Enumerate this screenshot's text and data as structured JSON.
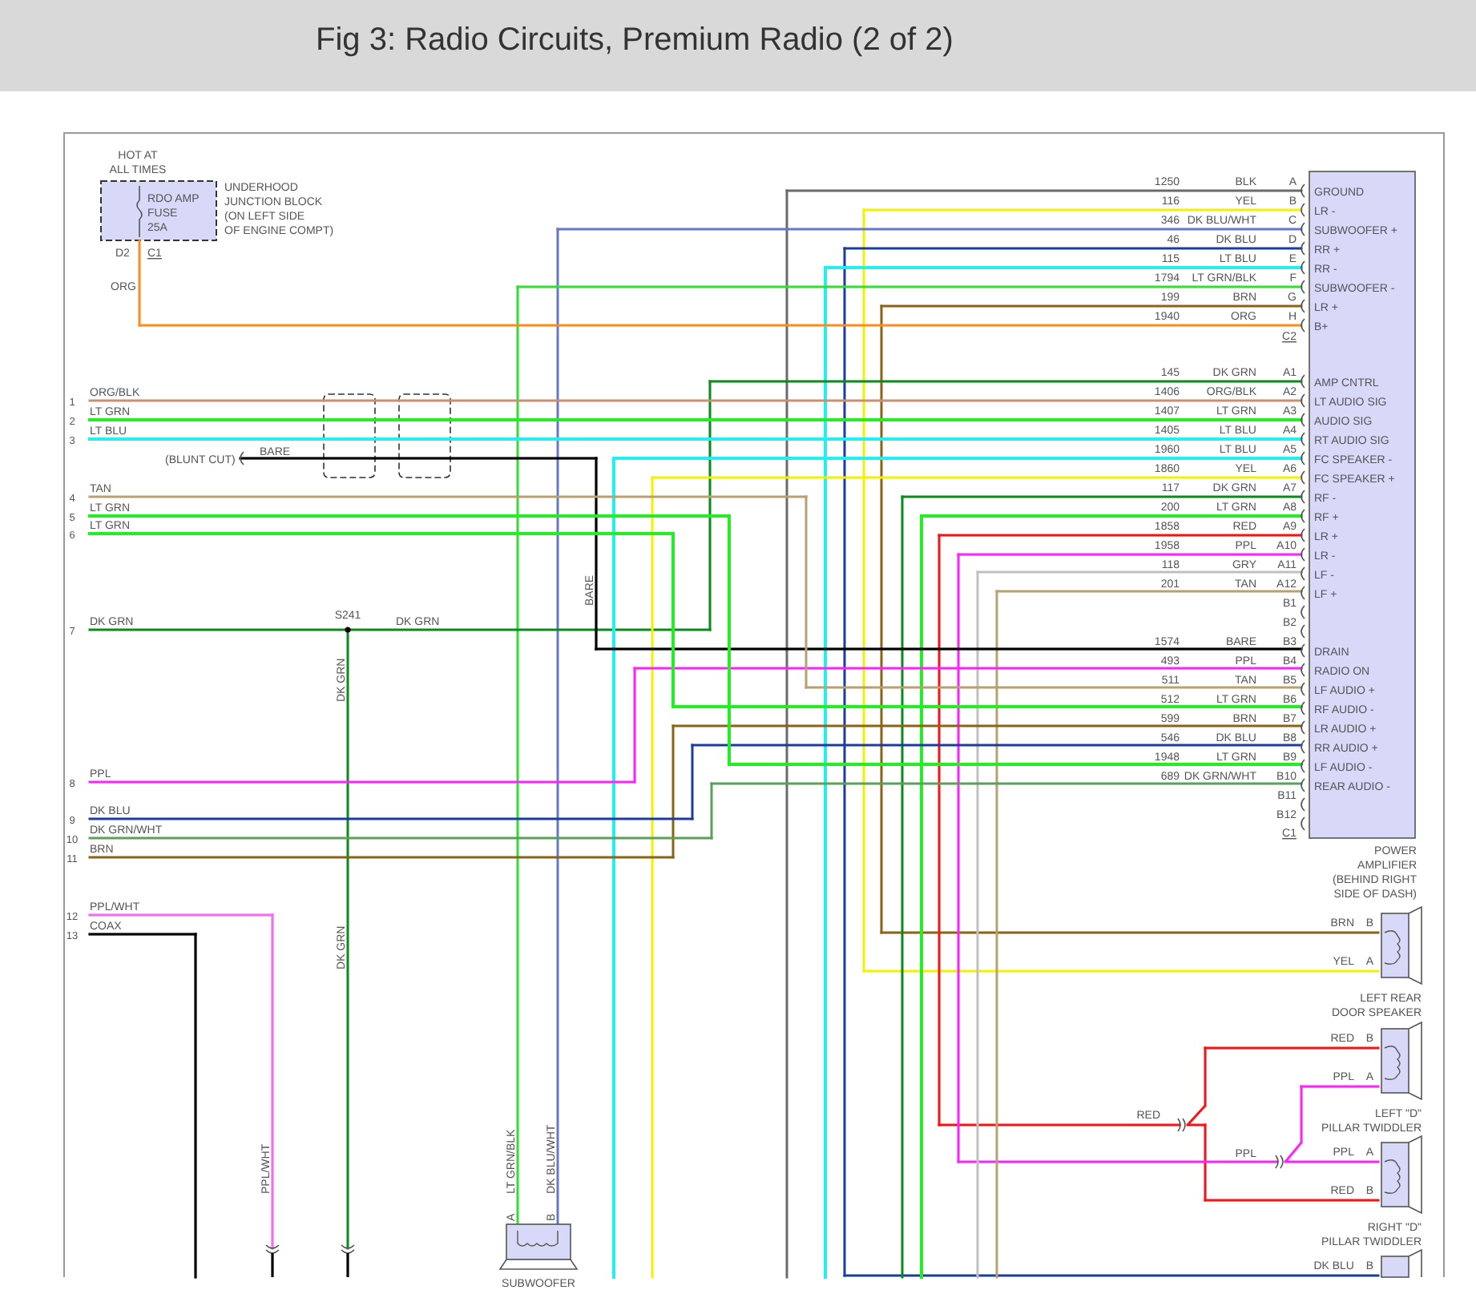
{
  "header": {
    "title": "Fig 3: Radio Circuits, Premium Radio (2 of 2)"
  },
  "fuse_block": {
    "supply_label": [
      "HOT AT",
      "ALL TIMES"
    ],
    "fuse_label": [
      "RDO AMP",
      "FUSE",
      "25A"
    ],
    "location": [
      "UNDERHOOD",
      "JUNCTION BLOCK",
      "(ON LEFT SIDE",
      "OF ENGINE COMPT)"
    ],
    "pin": "D2",
    "connector": "C1",
    "wire": "ORG"
  },
  "harness_wires": [
    {
      "number": "1",
      "label": "ORG/BLK"
    },
    {
      "number": "2",
      "label": "LT GRN"
    },
    {
      "number": "3",
      "label": "LT BLU"
    },
    {
      "number": "4",
      "label": "TAN"
    },
    {
      "number": "5",
      "label": "LT GRN"
    },
    {
      "number": "6",
      "label": "LT GRN"
    },
    {
      "number": "7",
      "label": "DK GRN"
    },
    {
      "number": "8",
      "label": "PPL"
    },
    {
      "number": "9",
      "label": "DK BLU"
    },
    {
      "number": "10",
      "label": "DK GRN/WHT"
    },
    {
      "number": "11",
      "label": "BRN"
    },
    {
      "number": "12",
      "label": "PPL/WHT",
      "vertical_label": "PPL/WHT",
      "color": "#f070f0"
    },
    {
      "number": "13",
      "label": "COAX",
      "color": "#000000"
    }
  ],
  "drain": {
    "end_label": "(BLUNT CUT)",
    "wire": "BARE",
    "vertical_label": "BARE"
  },
  "splice": {
    "name": "S241",
    "wire_label": "DK GRN",
    "branch_labels": [
      "DK GRN",
      "DK GRN"
    ]
  },
  "power_amplifier": {
    "name": [
      "POWER",
      "AMPLIFIER",
      "(BEHIND RIGHT",
      "SIDE OF DASH)"
    ],
    "c2_pins": [
      {
        "circuit": "1250",
        "wire": "BLK",
        "pin": "A",
        "function": "GROUND",
        "color": "#6b6b6b"
      },
      {
        "circuit": "116",
        "wire": "YEL",
        "pin": "B",
        "function": "LR -",
        "color": "#f2f200"
      },
      {
        "circuit": "346",
        "wire": "DK BLU/WHT",
        "pin": "C",
        "function": "SUBWOOFER +",
        "color": "#6677cc"
      },
      {
        "circuit": "46",
        "wire": "DK BLU",
        "pin": "D",
        "function": "RR +",
        "color": "#1c3c9c"
      },
      {
        "circuit": "115",
        "wire": "LT BLU",
        "pin": "E",
        "function": "RR -",
        "color": "#22f0f0"
      },
      {
        "circuit": "1794",
        "wire": "LT GRN/BLK",
        "pin": "F",
        "function": "SUBWOOFER -",
        "color": "#33dd33"
      },
      {
        "circuit": "199",
        "wire": "BRN",
        "pin": "G",
        "function": "LR +",
        "color": "#8a6414"
      },
      {
        "circuit": "1940",
        "wire": "ORG",
        "pin": "H",
        "function": "B+",
        "color": "#ff8c1a"
      }
    ],
    "c2_label": "C2",
    "c1_pins": [
      {
        "circuit": "145",
        "wire": "DK GRN",
        "pin": "A1",
        "function": "AMP CNTRL",
        "color": "#0a8a1a"
      },
      {
        "circuit": "1406",
        "wire": "ORG/BLK",
        "pin": "A2",
        "function": "LT AUDIO SIG",
        "color": "#c89070"
      },
      {
        "circuit": "1407",
        "wire": "LT GRN",
        "pin": "A3",
        "function": "AUDIO SIG",
        "color": "#22ee22"
      },
      {
        "circuit": "1405",
        "wire": "LT BLU",
        "pin": "A4",
        "function": "RT AUDIO SIG",
        "color": "#22f0f0"
      },
      {
        "circuit": "1960",
        "wire": "LT BLU",
        "pin": "A5",
        "function": "FC SPEAKER -",
        "color": "#22f0f0"
      },
      {
        "circuit": "1860",
        "wire": "YEL",
        "pin": "A6",
        "function": "FC SPEAKER +",
        "color": "#f2f200"
      },
      {
        "circuit": "117",
        "wire": "DK GRN",
        "pin": "A7",
        "function": "RF -",
        "color": "#0a8a1a"
      },
      {
        "circuit": "200",
        "wire": "LT GRN",
        "pin": "A8",
        "function": "RF +",
        "color": "#22ee22"
      },
      {
        "circuit": "1858",
        "wire": "RED",
        "pin": "A9",
        "function": "LR +",
        "color": "#ff1010"
      },
      {
        "circuit": "1958",
        "wire": "PPL",
        "pin": "A10",
        "function": "LR -",
        "color": "#ff22ff"
      },
      {
        "circuit": "118",
        "wire": "GRY",
        "pin": "A11",
        "function": "LF -",
        "color": "#c0c0c0"
      },
      {
        "circuit": "201",
        "wire": "TAN",
        "pin": "A12",
        "function": "LF +",
        "color": "#b8a070"
      },
      {
        "pin": "B1"
      },
      {
        "pin": "B2"
      },
      {
        "circuit": "1574",
        "wire": "BARE",
        "pin": "B3",
        "function": "DRAIN",
        "color": "#000000"
      },
      {
        "circuit": "493",
        "wire": "PPL",
        "pin": "B4",
        "function": "RADIO ON",
        "color": "#ff22ff"
      },
      {
        "circuit": "511",
        "wire": "TAN",
        "pin": "B5",
        "function": "LF AUDIO +",
        "color": "#b8a070"
      },
      {
        "circuit": "512",
        "wire": "LT GRN",
        "pin": "B6",
        "function": "RF AUDIO -",
        "color": "#22ee22"
      },
      {
        "circuit": "599",
        "wire": "BRN",
        "pin": "B7",
        "function": "LR AUDIO +",
        "color": "#8a6414"
      },
      {
        "circuit": "546",
        "wire": "DK BLU",
        "pin": "B8",
        "function": "RR AUDIO +",
        "color": "#1c3c9c"
      },
      {
        "circuit": "1948",
        "wire": "LT GRN",
        "pin": "B9",
        "function": "LF AUDIO -",
        "color": "#22ee22"
      },
      {
        "circuit": "689",
        "wire": "DK GRN/WHT",
        "pin": "B10",
        "function": "REAR AUDIO -",
        "color": "#5aa05a"
      },
      {
        "pin": "B11"
      },
      {
        "pin": "B12"
      }
    ],
    "c1_label": "C1"
  },
  "speakers": [
    {
      "name": [
        "LEFT REAR",
        "DOOR SPEAKER"
      ],
      "pins": [
        {
          "wire": "BRN",
          "pin": "B"
        },
        {
          "wire": "YEL",
          "pin": "A"
        }
      ]
    },
    {
      "name": [
        "LEFT \"D\"",
        "PILLAR TWIDDLER"
      ],
      "pins": [
        {
          "wire": "RED",
          "pin": "B"
        },
        {
          "wire": "PPL",
          "pin": "A"
        }
      ]
    },
    {
      "name": [
        "RIGHT \"D\"",
        "PILLAR TWIDDLER"
      ],
      "pins": [
        {
          "wire": "PPL",
          "pin": "A"
        },
        {
          "wire": "RED",
          "pin": "B"
        }
      ]
    },
    {
      "pins": [
        {
          "wire": "DK BLU",
          "pin": "B"
        }
      ]
    }
  ],
  "inline_connectors": [
    {
      "wire": "RED"
    },
    {
      "wire": "PPL"
    }
  ],
  "subwoofer": {
    "name": "SUBWOOFER",
    "pins": [
      {
        "pin": "A",
        "wire": "LT GRN/BLK"
      },
      {
        "pin": "B",
        "wire": "DK BLU/WHT"
      }
    ]
  }
}
